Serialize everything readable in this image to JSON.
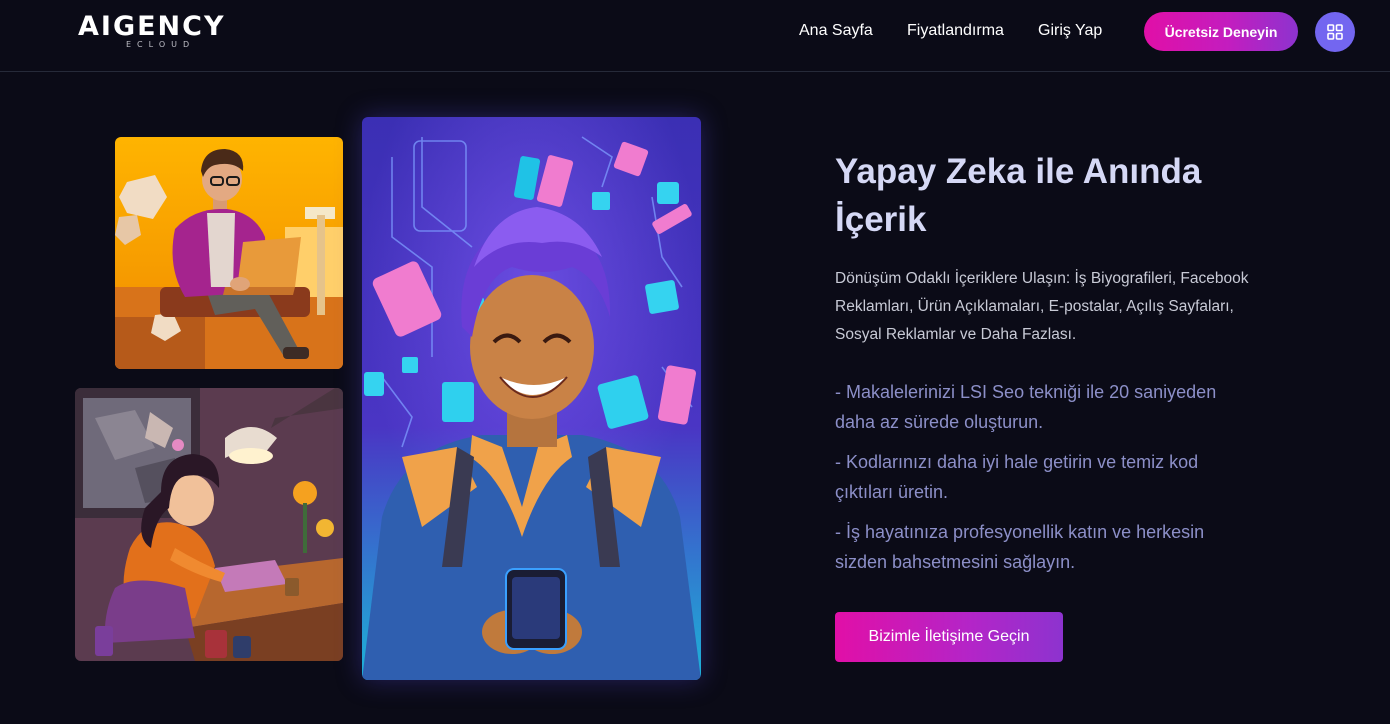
{
  "header": {
    "logo_main": "AIGENCY",
    "logo_sub": "ECLOUD",
    "nav": {
      "home": "Ana Sayfa",
      "pricing": "Fiyatlandırma",
      "login": "Giriş Yap"
    },
    "cta_label": "Ücretsiz Deneyin",
    "menu_icon": "grid-icon"
  },
  "hero": {
    "title": "Yapay Zeka ile Anında İçerik",
    "description": "Dönüşüm Odaklı İçeriklere Ulaşın: İş Biyografileri, Facebook Reklamları, Ürün Açıklamaları, E-postalar, Açılış Sayfaları, Sosyal Reklamlar ve Daha Fazlası.",
    "features": [
      "- Makalelerinizi LSI Seo tekniği ile 20 saniyeden daha az sürede oluşturun.",
      "- Kodlarınızı daha iyi hale getirin ve temiz kod çıktıları üretin.",
      "- İş hayatınıza profesyonellik katın ve herkesin sizden bahsetmesini sağlayın."
    ],
    "contact_label": "Bizimle İletişime Geçin"
  },
  "colors": {
    "background": "#0b0b17",
    "accent_pink": "#e10fa7",
    "accent_purple": "#8d33cf",
    "grid_button": "#7366f0",
    "title": "#d5d8f5",
    "feature_text": "#8c8fc8"
  }
}
